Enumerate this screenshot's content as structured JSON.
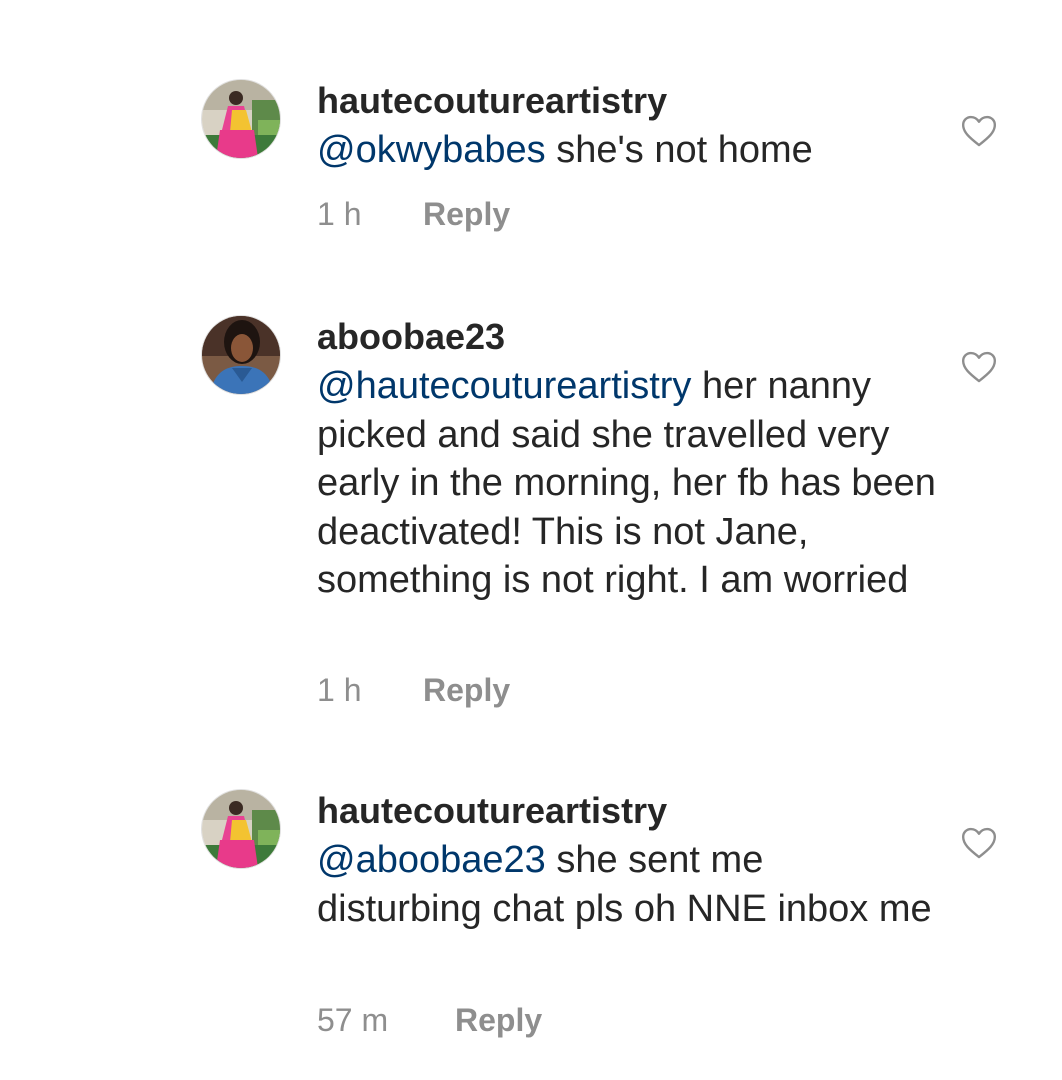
{
  "comments": [
    {
      "username": "hautecoutureartistry",
      "mention": "@okwybabes",
      "text": " she's not home",
      "time": "1 h",
      "reply_label": "Reply",
      "like_icon": "heart-outline-icon"
    },
    {
      "username": "aboobae23",
      "mention": "@hautecoutureartistry",
      "text": " her nanny picked and said she travelled very early in the morning, her fb has been deactivated! This is not Jane, something is not right. I am worried",
      "time": "1 h",
      "reply_label": "Reply",
      "like_icon": "heart-outline-icon"
    },
    {
      "username": "hautecoutureartistry",
      "mention": "@aboobae23",
      "text": " she sent me disturbing chat pls oh NNE inbox me",
      "time": "57 m",
      "reply_label": "Reply",
      "like_icon": "heart-outline-icon"
    }
  ],
  "colors": {
    "text": "#262626",
    "mention": "#00376b",
    "secondary": "#8e8e8e"
  }
}
